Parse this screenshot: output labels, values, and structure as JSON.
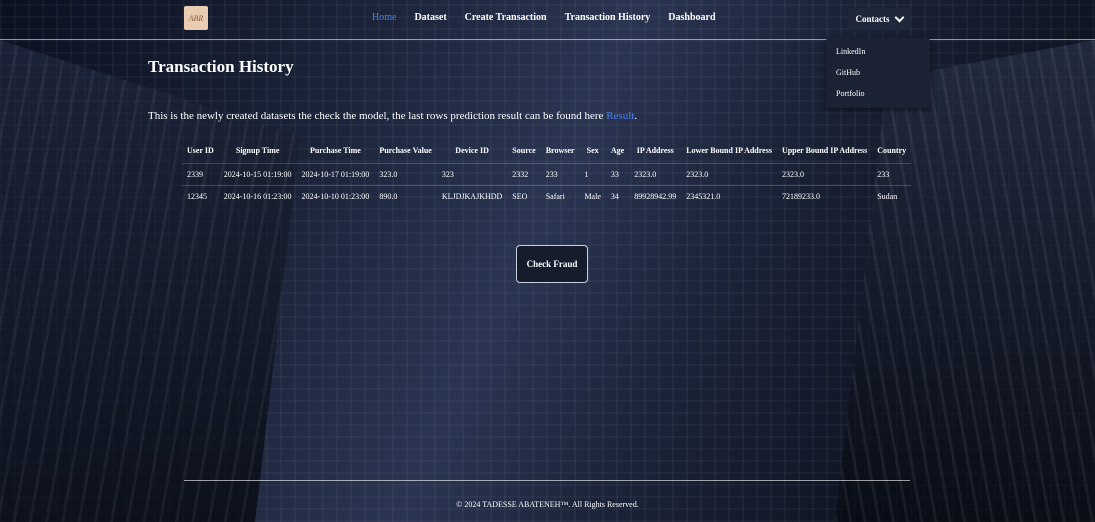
{
  "nav": {
    "logo_text": "ABR",
    "links": [
      {
        "label": "Home",
        "active": true
      },
      {
        "label": "Dataset",
        "active": false
      },
      {
        "label": "Create Transaction",
        "active": false
      },
      {
        "label": "Transaction History",
        "active": false
      },
      {
        "label": "Dashboard",
        "active": false
      }
    ],
    "contacts_label": "Contacts",
    "contacts_menu": [
      "LinkedIn",
      "GitHub",
      "Portfolio"
    ]
  },
  "page": {
    "title": "Transaction History",
    "intro_text": "This is the newly created datasets the check the model, the last rows prediction result can be found here ",
    "intro_link": "Result",
    "intro_end": "."
  },
  "table": {
    "headers": [
      "User ID",
      "Signup Time",
      "Purchase Time",
      "Purchase Value",
      "Device ID",
      "Source",
      "Browser",
      "Sex",
      "Age",
      "IP Address",
      "Lower Bound IP Address",
      "Upper Bound IP Address",
      "Country"
    ],
    "rows": [
      [
        "2339",
        "2024-10-15 01:19:00",
        "2024-10-17 01:19:00",
        "323.0",
        "323",
        "2332",
        "233",
        "1",
        "33",
        "2323.0",
        "2323.0",
        "2323.0",
        "233"
      ],
      [
        "12345",
        "2024-10-16 01:23:00",
        "2024-10-10 01:23:00",
        "890.0",
        "KLJDJKAJKHDD",
        "SEO",
        "Safari",
        "Male",
        "34",
        "89928942.99",
        "2345321.0",
        "72189233.0",
        "Sudan"
      ]
    ]
  },
  "actions": {
    "check_fraud_label": "Check Fraud"
  },
  "footer": {
    "text": "© 2024 TADESSE ABATENEH™. All Rights Reserved."
  },
  "colors": {
    "link": "#4a7ef0",
    "background": "#1a2338"
  }
}
